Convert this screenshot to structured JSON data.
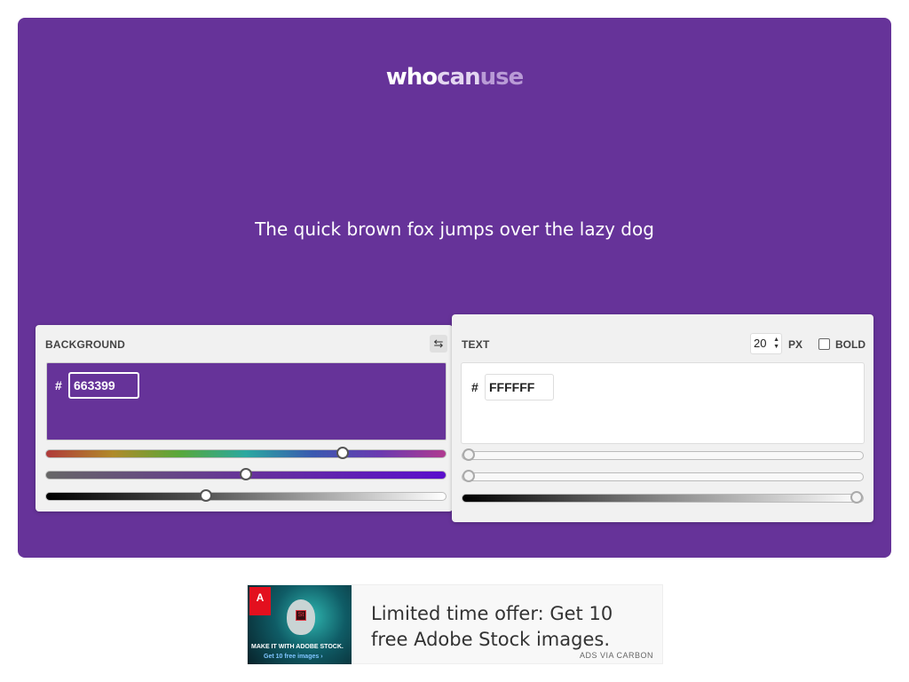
{
  "logo": {
    "part1": "who",
    "part2": "can",
    "part3": "use"
  },
  "sample_text": "The quick brown fox jumps over the lazy dog",
  "background_panel": {
    "title": "BACKGROUND",
    "hash": "#",
    "hex_value": "663399",
    "swap_icon": "swap-arrows-icon",
    "color": "#663399",
    "sliders": [
      {
        "name": "hue",
        "value": 0.742
      },
      {
        "name": "saturation",
        "value": 0.5
      },
      {
        "name": "lightness",
        "value": 0.4
      }
    ]
  },
  "text_panel": {
    "title": "TEXT",
    "hash": "#",
    "hex_value": "FFFFFF",
    "font_size": "20",
    "unit_label": "PX",
    "bold_label": "BOLD",
    "bold_checked": false,
    "color": "#FFFFFF",
    "sliders": [
      {
        "name": "hue",
        "value": 0.0
      },
      {
        "name": "saturation",
        "value": 0.0
      },
      {
        "name": "lightness",
        "value": 1.0
      }
    ]
  },
  "ad": {
    "logo_text": "A",
    "brand": "Adobe",
    "image_badge": "St",
    "image_line1": "MAKE IT WITH ADOBE STOCK.",
    "image_line2": "Get 10 free images ›",
    "copy": "Limited time offer: Get 10 free Adobe Stock images.",
    "via": "ADS VIA CARBON"
  }
}
